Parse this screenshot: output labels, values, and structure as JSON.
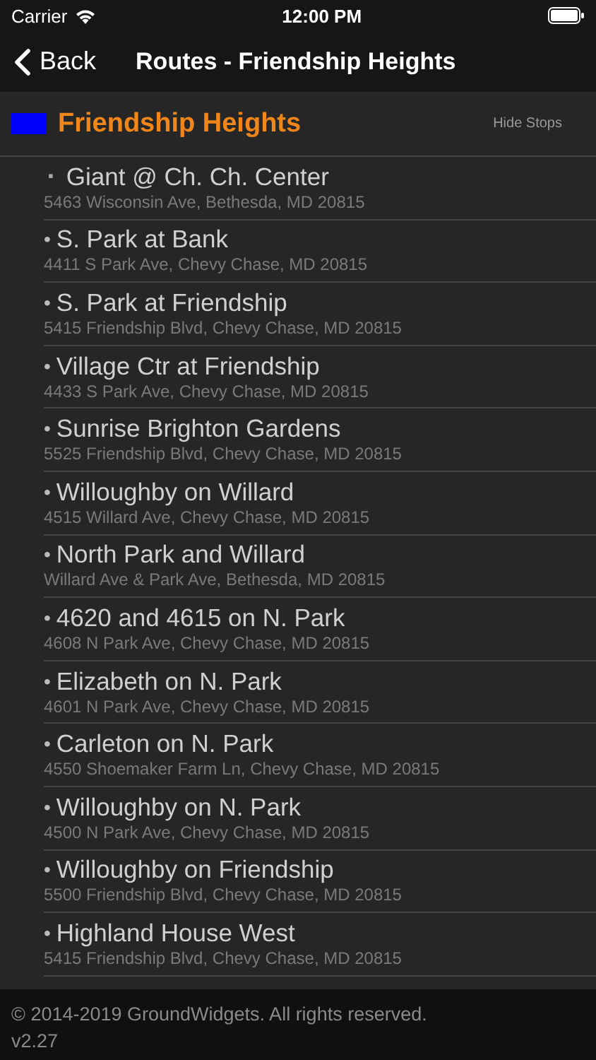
{
  "status_bar": {
    "carrier": "Carrier",
    "time": "12:00 PM"
  },
  "nav": {
    "back": "Back",
    "title": "Routes - Friendship Heights"
  },
  "route": {
    "name": "Friendship Heights",
    "color": "#0000ff",
    "toggle": "Hide Stops"
  },
  "stops": [
    {
      "marker": "▪",
      "kind": "current",
      "name": "Giant @ Ch. Ch. Center",
      "address": "5463 Wisconsin Ave, Bethesda, MD 20815"
    },
    {
      "marker": "•",
      "kind": "stop",
      "name": "S. Park at Bank",
      "address": "4411 S Park Ave, Chevy Chase, MD 20815"
    },
    {
      "marker": "•",
      "kind": "stop",
      "name": "S. Park at Friendship",
      "address": "5415 Friendship Blvd, Chevy Chase, MD 20815"
    },
    {
      "marker": "•",
      "kind": "stop",
      "name": "Village Ctr at Friendship",
      "address": "4433 S Park Ave, Chevy Chase, MD 20815"
    },
    {
      "marker": "•",
      "kind": "stop",
      "name": "Sunrise Brighton Gardens",
      "address": "5525 Friendship Blvd, Chevy Chase, MD 20815"
    },
    {
      "marker": "•",
      "kind": "stop",
      "name": "Willoughby on Willard",
      "address": "4515 Willard Ave, Chevy Chase, MD 20815"
    },
    {
      "marker": "•",
      "kind": "stop",
      "name": "North Park and Willard",
      "address": "Willard Ave & Park Ave, Bethesda, MD 20815"
    },
    {
      "marker": "•",
      "kind": "stop",
      "name": "4620 and 4615 on N. Park",
      "address": "4608 N Park Ave, Chevy Chase, MD 20815"
    },
    {
      "marker": "•",
      "kind": "stop",
      "name": "Elizabeth on N. Park",
      "address": "4601 N Park Ave, Chevy Chase, MD 20815"
    },
    {
      "marker": "•",
      "kind": "stop",
      "name": "Carleton on N. Park",
      "address": "4550 Shoemaker Farm Ln, Chevy Chase, MD 20815"
    },
    {
      "marker": "•",
      "kind": "stop",
      "name": "Willoughby on N. Park",
      "address": "4500 N Park Ave, Chevy Chase, MD 20815"
    },
    {
      "marker": "•",
      "kind": "stop",
      "name": "Willoughby on Friendship",
      "address": "5500 Friendship Blvd, Chevy Chase, MD 20815"
    },
    {
      "marker": "•",
      "kind": "stop",
      "name": "Highland House West",
      "address": "5415 Friendship Blvd, Chevy Chase, MD 20815"
    }
  ],
  "footer": {
    "copyright": "© 2014-2019 GroundWidgets.  All rights reserved.",
    "version": "v2.27"
  }
}
